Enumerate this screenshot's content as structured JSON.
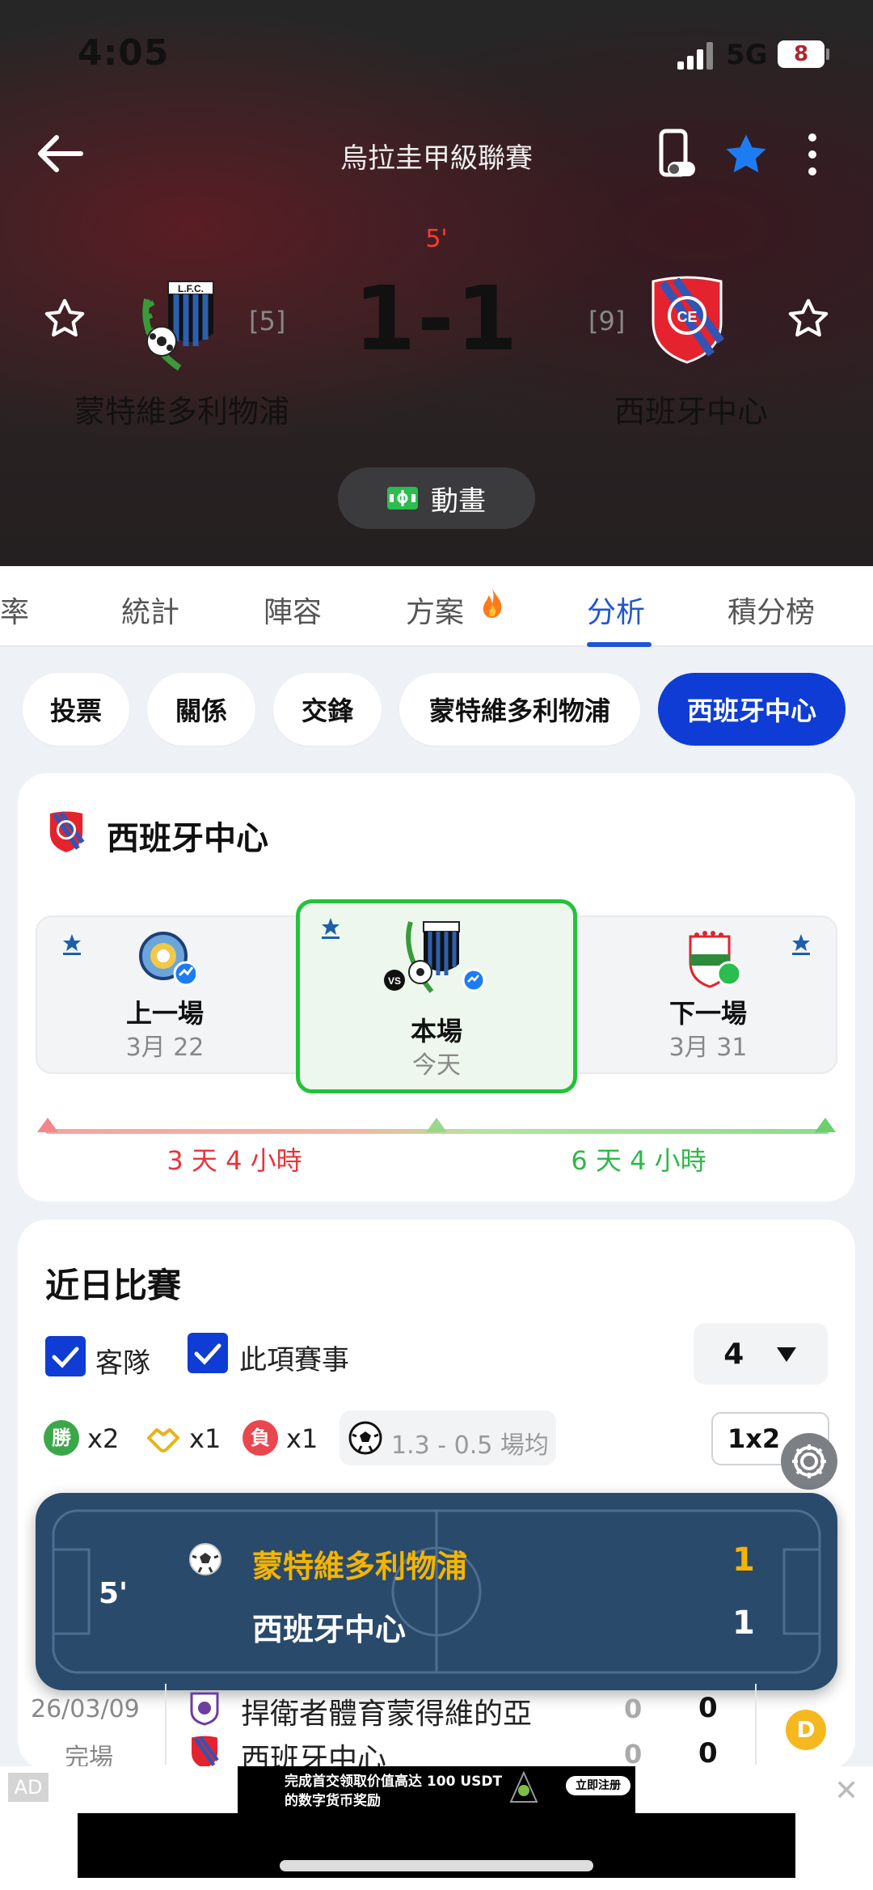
{
  "status_bar": {
    "time": "4:05",
    "network": "5G",
    "battery": "8"
  },
  "header": {
    "league": "烏拉圭甲級聯賽",
    "minute": "5'",
    "score": "1-1",
    "home": {
      "name": "蒙特維多利物浦",
      "rank": "[5]",
      "crest_text": "L.F.C."
    },
    "away": {
      "name": "西班牙中心",
      "rank": "[9]"
    },
    "animation_label": "動畫"
  },
  "tabs": [
    {
      "label": "賠率"
    },
    {
      "label": "統計"
    },
    {
      "label": "陣容"
    },
    {
      "label": "方案"
    },
    {
      "label": "分析",
      "active": true
    },
    {
      "label": "積分榜"
    }
  ],
  "chips": [
    {
      "label": "投票"
    },
    {
      "label": "關係"
    },
    {
      "label": "交鋒"
    },
    {
      "label": "蒙特維多利物浦"
    },
    {
      "label": "西班牙中心",
      "active": true
    }
  ],
  "team_card": {
    "title": "西班牙中心",
    "schedule": {
      "prev": {
        "label": "上一場",
        "date": "3月 22"
      },
      "current": {
        "label": "本場",
        "date": "今天",
        "vs": "VS"
      },
      "next": {
        "label": "下一場",
        "date": "3月 31"
      }
    },
    "gap_before": "3 天 4 小時",
    "gap_after": "6 天 4 小時"
  },
  "recent": {
    "title": "近日比賽",
    "filter_away": "客隊",
    "filter_competition": "此項賽事",
    "count": "4",
    "wins": "x2",
    "draws": "x1",
    "losses": "x1",
    "win_icon": "勝",
    "loss_icon": "負",
    "goal_avg": "1.3 - 0.5 場均",
    "odds_type": "1x2"
  },
  "live_popup": {
    "minute": "5'",
    "home": "蒙特維多利物浦",
    "away": "西班牙中心",
    "home_score": "1",
    "away_score": "1"
  },
  "match_row": {
    "date": "26/03/09",
    "status": "完場",
    "home": "捍衛者體育蒙得維的亞",
    "away": "西班牙中心",
    "home_ht": "0",
    "home_ft": "0",
    "away_ht": "0",
    "away_ft": "0",
    "result": "D"
  },
  "ad": {
    "label": "AD",
    "line1": "完成首交领取价值高达 100 USDT",
    "line2": "的数字货币奖励",
    "cta": "立即注册",
    "close": "✕"
  },
  "colors": {
    "accent": "#1d55d6",
    "chip_active": "#0e3cd4",
    "live_bg": "#294a6b",
    "win": "#3aa84a",
    "loss": "#e8474f",
    "draw": "#f5b81f"
  }
}
